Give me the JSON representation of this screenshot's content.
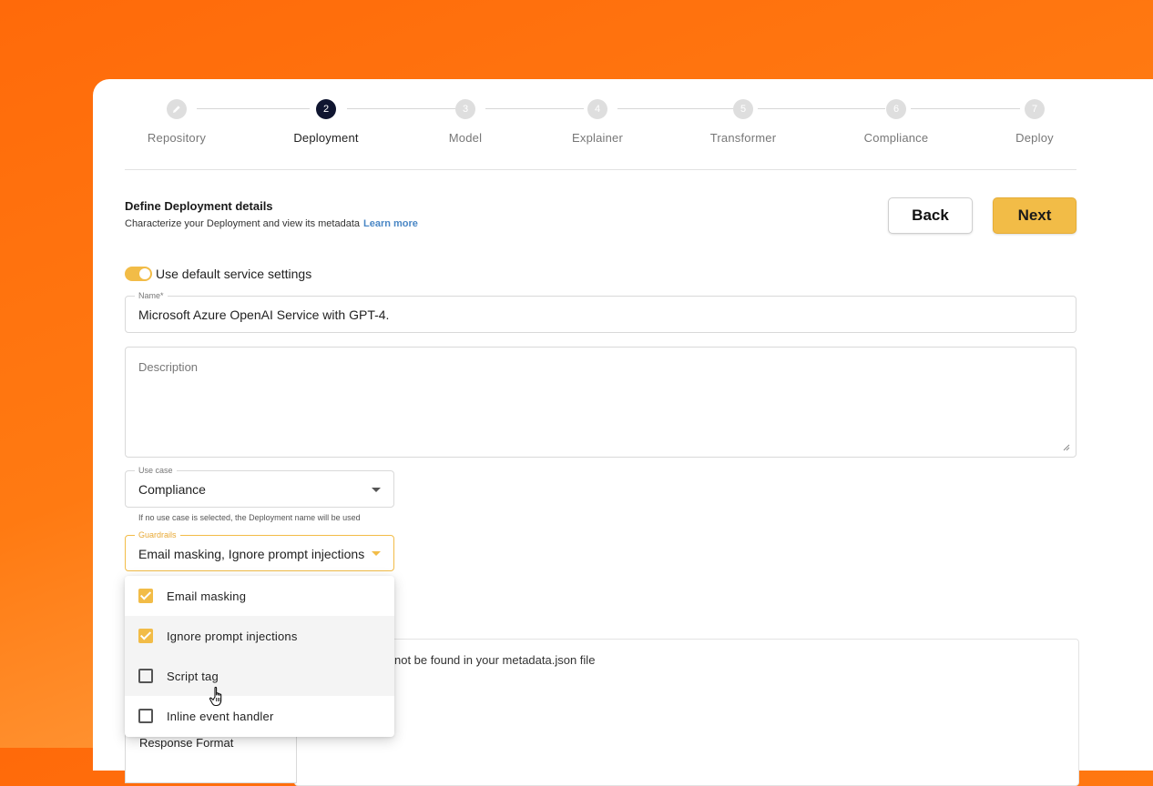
{
  "stepper": {
    "steps": [
      {
        "number": "",
        "label": "Repository",
        "state": "done"
      },
      {
        "number": "2",
        "label": "Deployment",
        "state": "active"
      },
      {
        "number": "3",
        "label": "Model",
        "state": "upcoming"
      },
      {
        "number": "4",
        "label": "Explainer",
        "state": "upcoming"
      },
      {
        "number": "5",
        "label": "Transformer",
        "state": "upcoming"
      },
      {
        "number": "6",
        "label": "Compliance",
        "state": "upcoming"
      },
      {
        "number": "7",
        "label": "Deploy",
        "state": "upcoming"
      }
    ]
  },
  "header": {
    "title": "Define Deployment details",
    "subtitle": "Characterize your Deployment and view its metadata",
    "learn_more": "Learn more"
  },
  "buttons": {
    "back": "Back",
    "next": "Next"
  },
  "toggle": {
    "label": "Use default service settings",
    "on": true
  },
  "name_field": {
    "legend": "Name*",
    "value": "Microsoft Azure OpenAI Service with GPT-4."
  },
  "description_field": {
    "placeholder": "Description"
  },
  "use_case_field": {
    "legend": "Use case",
    "value": "Compliance",
    "helper": "If no use case is selected, the Deployment name will be used"
  },
  "guardrails_field": {
    "legend": "Guardrails",
    "value": "Email masking, Ignore prompt injections"
  },
  "guardrails_options": [
    {
      "label": "Email masking",
      "checked": true
    },
    {
      "label": "Ignore prompt injections",
      "checked": true
    },
    {
      "label": "Script tag",
      "checked": false
    },
    {
      "label": "Inline event handler",
      "checked": false
    }
  ],
  "metadata_notice": "not be found in your metadata.json file",
  "response_format_label": "Response Format",
  "colors": {
    "accent": "#f2bc47",
    "active_step": "#0f1530",
    "link": "#4a87c5",
    "background_orange": "#ff6a0a"
  }
}
